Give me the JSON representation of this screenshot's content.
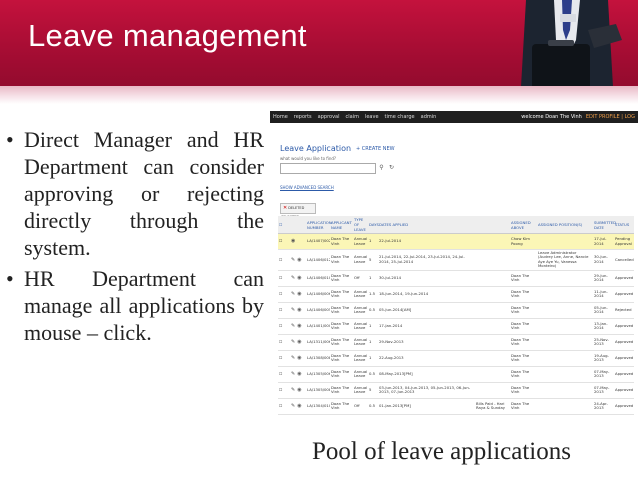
{
  "slide": {
    "title": "Leave management",
    "bullets": [
      "Direct Manager and HR Department can consider approving or rejecting directly through the system.",
      "HR Department can manage all applications by mouse – click."
    ],
    "caption": "Pool of leave applications"
  },
  "app": {
    "nav": [
      "Home",
      "reports",
      "approval",
      "claim",
      "leave",
      "time charge",
      "admin"
    ],
    "welcome": "welcome Doan The Vinh",
    "edit_profile": "EDIT PROFILE | LOG",
    "title": "Leave Application",
    "create_new": "+ CREATE NEW",
    "search_label": "what would you like to find?",
    "advanced_search": "SHOW ADVANCED SEARCH",
    "delete_selected": "DELETED SELECTED",
    "columns": [
      "",
      "",
      "APPLICATION NUMBER",
      "APPLICANT NAME",
      "TYPE OF LEAVE",
      "DAYS",
      "DATES APPLIED",
      "",
      "ASSIGNED ABOVE",
      "ASSIGNED POSITION(S)",
      "SUBMITTED DATE",
      "STATUS"
    ],
    "rows": [
      {
        "no": "LA/1407/0020",
        "name": "Doan The Vinh",
        "type": "Annual Leave",
        "days": "1",
        "dates": "22-Jul-2014",
        "note": "",
        "assigned": "Chow Kim Poong",
        "positions": "",
        "submitted": "17-Jul-2014",
        "status": "Pending Approval",
        "hl": true
      },
      {
        "no": "LA/1406/0123",
        "name": "Doan The Vinh",
        "type": "Annual Leave",
        "days": "5",
        "dates": "21-Jul-2014, 22-Jul-2014, 23-Jul-2014, 24-Jul-2014, 25-Jul-2014",
        "note": "",
        "assigned": "",
        "positions": "Leave Administrator (Audrey Lee, Anne, Nancie Aye Aye Yu, Vanessa Monteiro)",
        "submitted": "30-Jun-2014",
        "status": "Cancelled",
        "hl": false
      },
      {
        "no": "LA/1406/0101",
        "name": "Doan The Vinh",
        "type": "Off",
        "days": "1",
        "dates": "30-Jul-2014",
        "note": "",
        "assigned": "Doan The Vinh",
        "positions": "",
        "submitted": "29-Jun-2014",
        "status": "Approved",
        "hl": false
      },
      {
        "no": "LA/1406/0069",
        "name": "Doan The Vinh",
        "type": "Annual Leave",
        "days": "1.5",
        "dates": "18-Jun-2014, 19-Jun-2014",
        "note": "",
        "assigned": "Doan The Vinh",
        "positions": "",
        "submitted": "11-Jun-2014",
        "status": "Approved",
        "hl": false
      },
      {
        "no": "LA/1406/0058",
        "name": "Doan The Vinh",
        "type": "Annual Leave",
        "days": "0.5",
        "dates": "05-Jun-2014[AM]",
        "note": "",
        "assigned": "Doan The Vinh",
        "positions": "",
        "submitted": "05-Jun-2014",
        "status": "Rejected",
        "hl": false
      },
      {
        "no": "LA/1401/0008",
        "name": "Doan The Vinh",
        "type": "Annual Leave",
        "days": "1",
        "dates": "17-Jan-2014",
        "note": "",
        "assigned": "Doan The Vinh",
        "positions": "",
        "submitted": "13-Jan-2014",
        "status": "Approved",
        "hl": false
      },
      {
        "no": "LA/1311/0065",
        "name": "Doan The Vinh",
        "type": "Annual Leave",
        "days": "1",
        "dates": "29-Nov-2013",
        "note": "",
        "assigned": "Doan The Vinh",
        "positions": "",
        "submitted": "25-Nov-2013",
        "status": "Approved",
        "hl": false
      },
      {
        "no": "LA/1308/0089",
        "name": "Doan The Vinh",
        "type": "Annual Leave",
        "days": "1",
        "dates": "22-Aug-2013",
        "note": "",
        "assigned": "Doan The Vinh",
        "positions": "",
        "submitted": "19-Aug-2013",
        "status": "Approved",
        "hl": false
      },
      {
        "no": "LA/1305/0065",
        "name": "Doan The Vinh",
        "type": "Annual Leave",
        "days": "0.5",
        "dates": "08-May-2013[PM]",
        "note": "",
        "assigned": "Doan The Vinh",
        "positions": "",
        "submitted": "07-May-2013",
        "status": "Approved",
        "hl": false
      },
      {
        "no": "LA/1305/0089",
        "name": "Doan The Vinh",
        "type": "Annual Leave",
        "days": "5",
        "dates": "03-Jun-2013, 04-Jun-2013, 05-Jun-2013, 06-Jun-2013, 07-Jun-2013",
        "note": "",
        "assigned": "Doan The Vinh",
        "positions": "",
        "submitted": "07-May-2013",
        "status": "Approved",
        "hl": false
      },
      {
        "no": "LA/1304/0100",
        "name": "Doan The Vinh",
        "type": "Off",
        "days": "0.5",
        "dates": "01-Jan-2013[PM]",
        "note": "Bills Paid - Hari Raya & Sunday",
        "assigned": "Doan The Vinh",
        "positions": "",
        "submitted": "24-Apr-2013",
        "status": "Approved",
        "hl": false
      }
    ]
  }
}
